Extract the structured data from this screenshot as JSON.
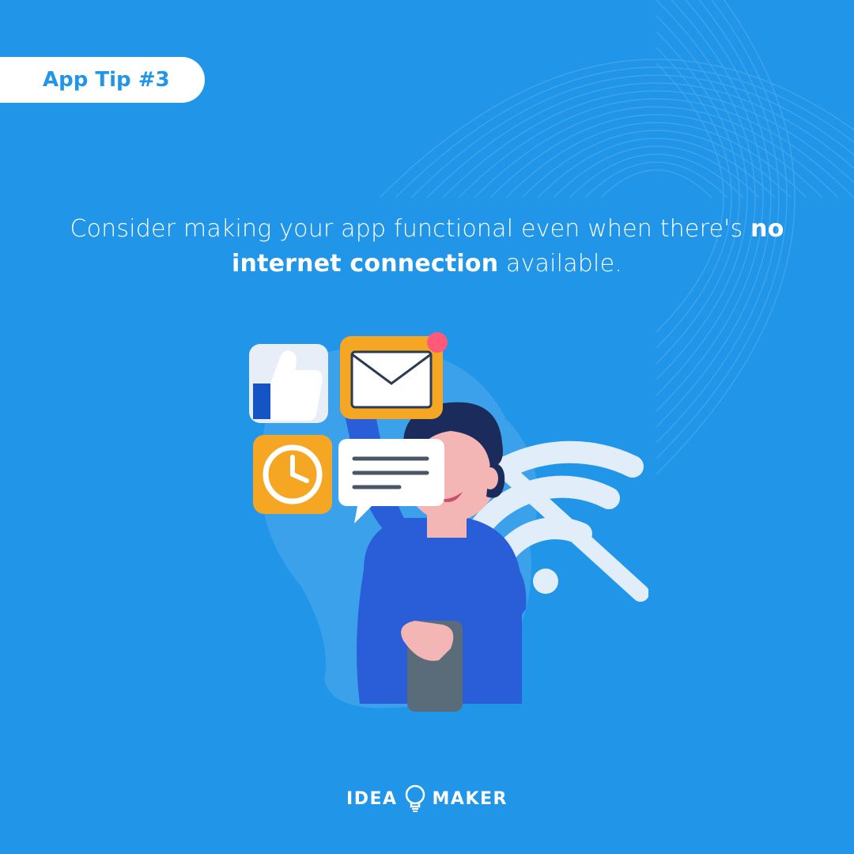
{
  "badge": {
    "label": "App Tip #3"
  },
  "headline": {
    "pre": "Consider making your app functional even when there's ",
    "bold": "no internet connection",
    "post": " available."
  },
  "logo": {
    "left": "IDEA",
    "right": "MAKER"
  }
}
